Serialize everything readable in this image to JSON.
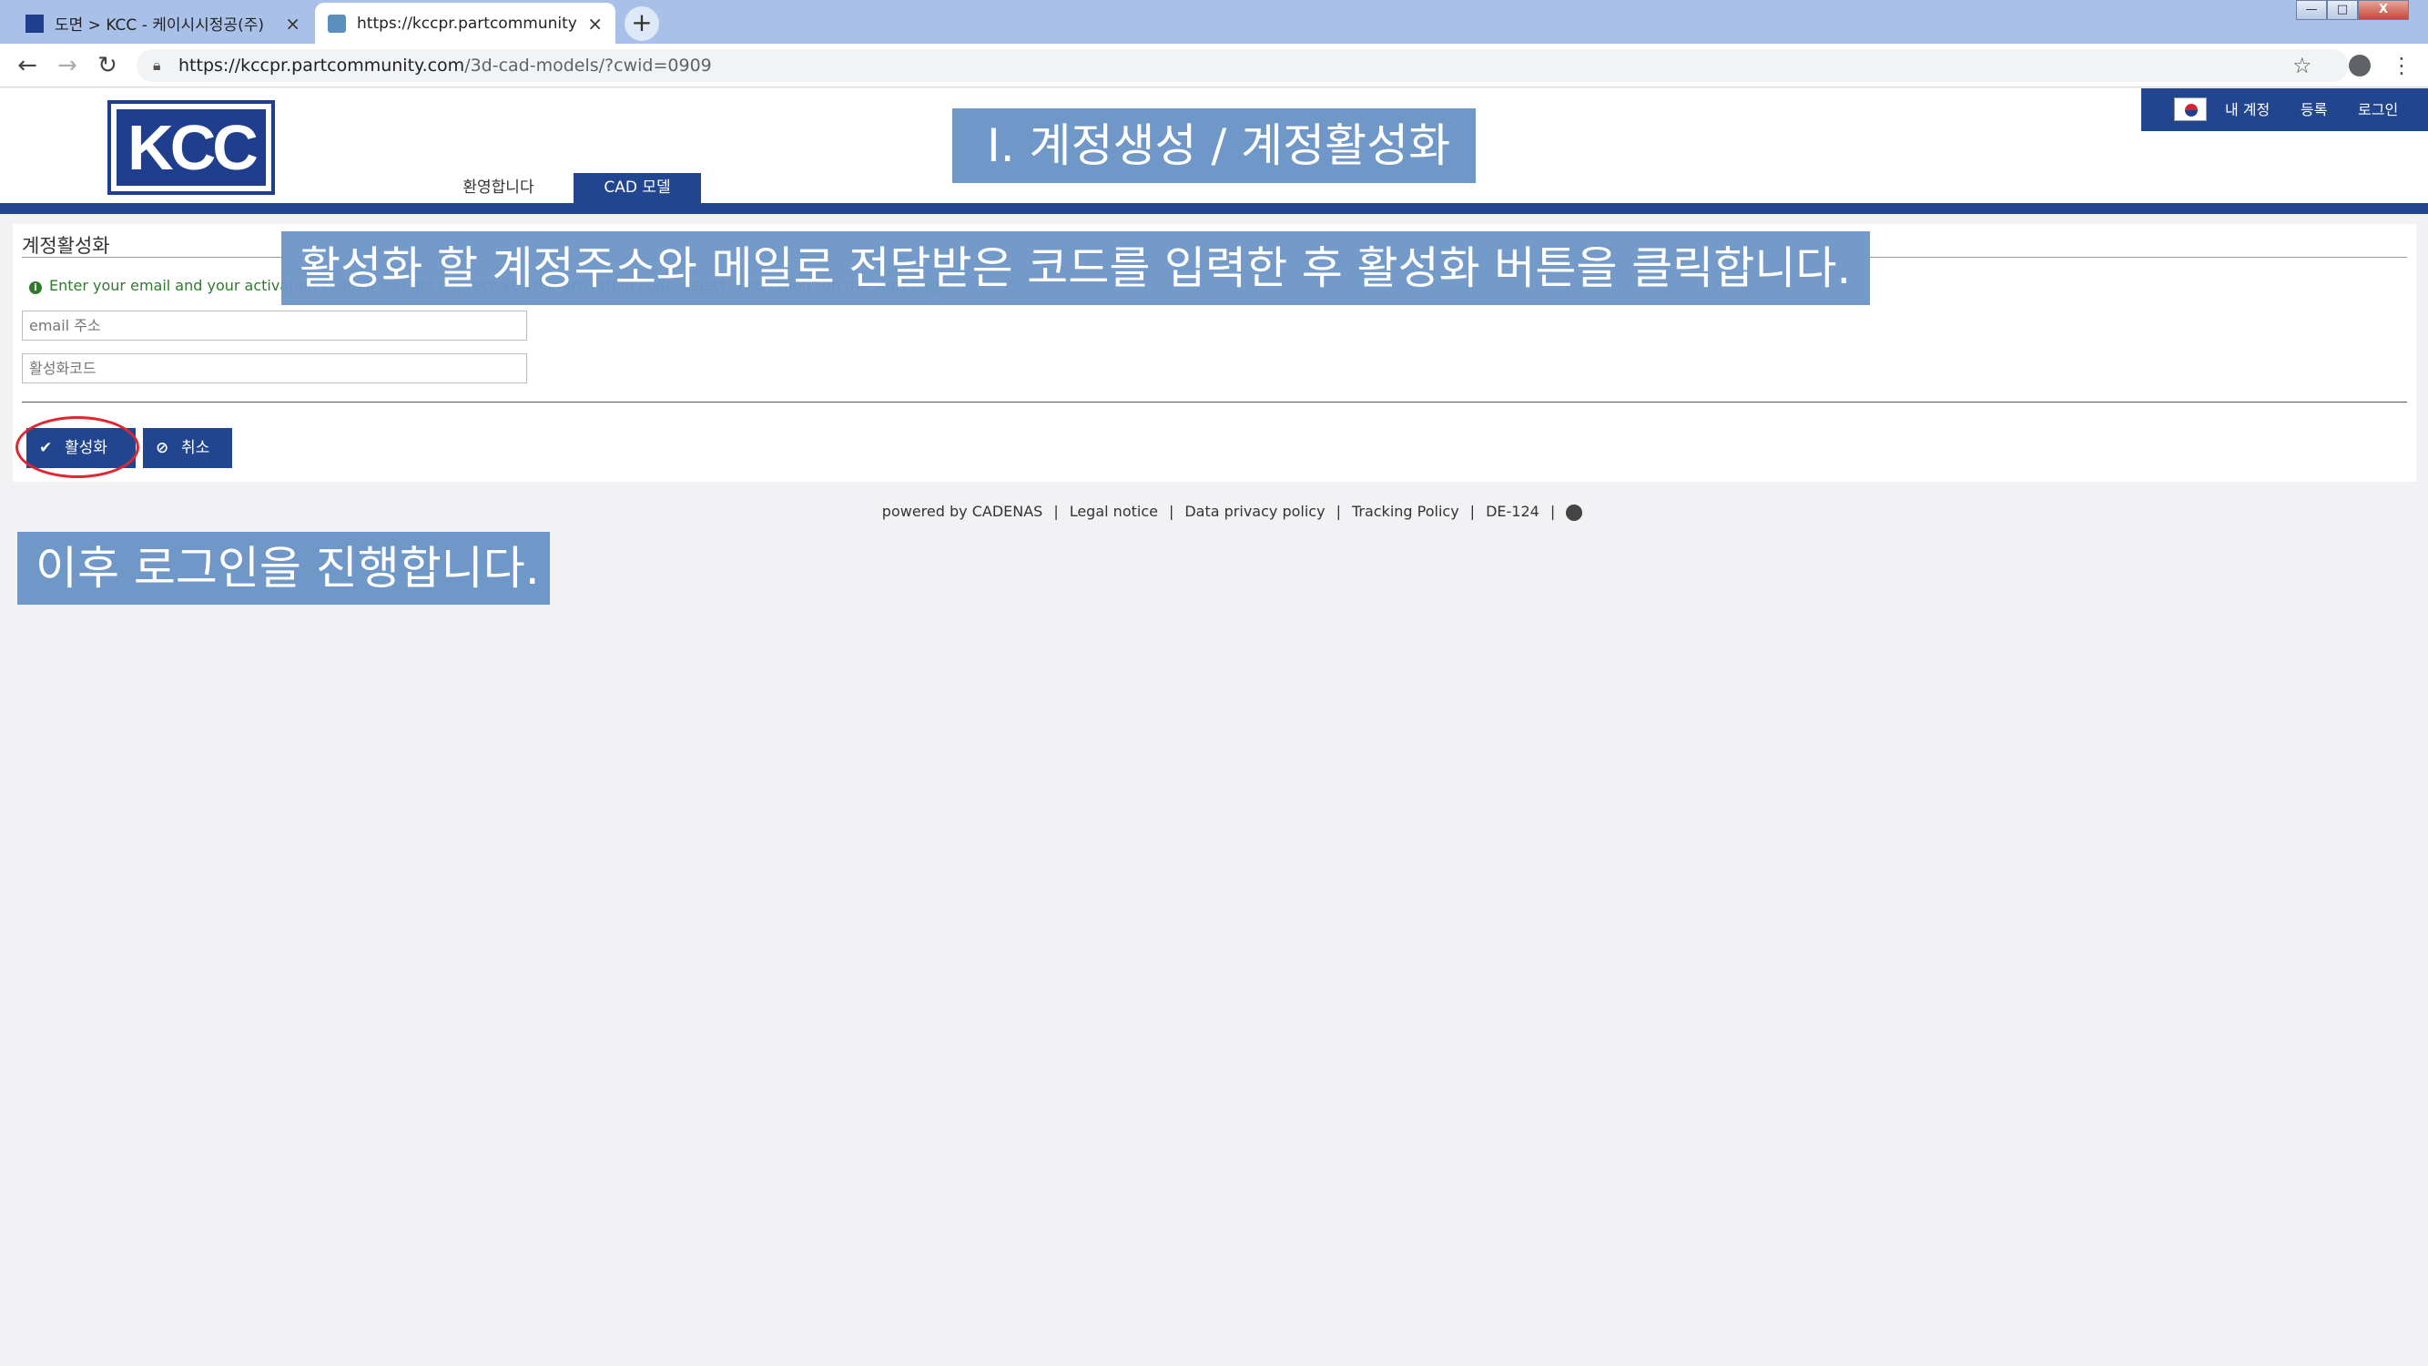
{
  "browser": {
    "tabs": [
      {
        "title": "도면 > KCC - 케이시시정공(주)",
        "close": "×"
      },
      {
        "title": "https://kccpr.partcommunity.co",
        "close": "×"
      }
    ],
    "new_tab": "+",
    "window_controls": {
      "minimize": "—",
      "maximize": "□",
      "close": "X"
    },
    "url_host": "https://kccpr.partcommunity.com",
    "url_path": "/3d-cad-models/?cwid=0909",
    "back": "←",
    "forward": "→",
    "reload": "↻",
    "star": "☆",
    "menu": "⋮"
  },
  "site": {
    "logo": "KCC",
    "nav": {
      "welcome": "환영합니다",
      "cad_models": "CAD 모델"
    },
    "top_menu": {
      "my_account": "내 계정",
      "register": "등록",
      "login": "로그인"
    }
  },
  "form": {
    "title": "계정활성화",
    "hint": "Enter your email and your activation code. If you did not receive your activation code, select \"Activation\" on the start page.",
    "email_placeholder": "email 주소",
    "code_placeholder": "활성화코드",
    "activate_button": "활성화",
    "cancel_button": "취소"
  },
  "footer": {
    "powered": "powered by CADENAS",
    "legal": "Legal notice",
    "privacy": "Data privacy policy",
    "tracking": "Tracking Policy",
    "version": "DE-124",
    "sep": "|"
  },
  "annotations": {
    "step_title": "Ⅰ. 계정생성 / 계정활성화",
    "instruction": "활성화 할 계정주소와 메일로 전달받은 코드를 입력한 후 활성화 버튼을 클릭합니다.",
    "next": "이후 로그인을 진행합니다."
  },
  "colors": {
    "brand": "#22458f",
    "annotation": "#6f97c8",
    "highlight_circle": "#e0262f",
    "hint_green": "#2f7a2f"
  }
}
